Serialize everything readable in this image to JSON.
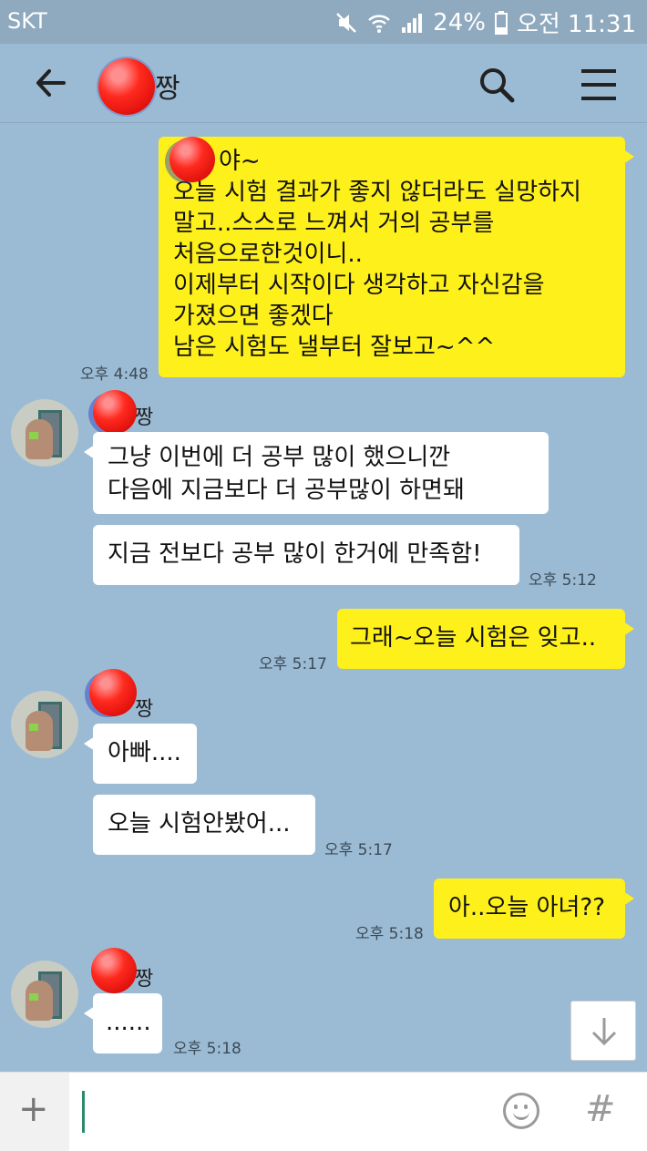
{
  "status_bar": {
    "carrier": "SKT",
    "battery": "24%",
    "time": "오전 11:31",
    "icons": [
      "mute-icon",
      "wifi-icon",
      "signal-icon",
      "battery-icon"
    ]
  },
  "header": {
    "title": "짱",
    "icons": [
      "back-arrow-icon",
      "search-icon",
      "menu-icon"
    ]
  },
  "messages": {
    "m1": {
      "lines": [
        "야~",
        "오늘 시험 결과가 좋지 않더라도 실망하지",
        "말고..스스로 느껴서 거의 공부를",
        "처음으로한것이니..",
        "이제부터 시작이다 생각하고 자신감을",
        "가졌으면 좋겠다",
        "남은 시험도 낼부터 잘보고~^^"
      ],
      "time": "오후 4:48"
    },
    "g1": {
      "name": "짱",
      "b1_lines": [
        "그냥 이번에 더 공부 많이 했으니깐",
        "다음에 지금보다 더 공부많이 하면돼"
      ],
      "b2": "지금 전보다 공부 많이 한거에 만족함!",
      "time": "오후 5:12"
    },
    "m2": {
      "text": "그래~오늘 시험은 잊고..",
      "time": "오후 5:17"
    },
    "g2": {
      "name": "짱",
      "b1": "아빠....",
      "b2": "오늘 시험안봤어...",
      "time": "오후 5:17"
    },
    "m3": {
      "text": "아..오늘 아녀??",
      "time": "오후 5:18"
    },
    "g3": {
      "name": "짱",
      "b1": "......",
      "time": "오후 5:18"
    }
  },
  "input_bar": {
    "plus": "+",
    "hash": "#",
    "icons": [
      "plus-icon",
      "emoji-icon",
      "hash-icon"
    ]
  },
  "colors": {
    "background": "#9bbbd4",
    "my_bubble": "#fef01b",
    "their_bubble": "#ffffff",
    "status_bar": "#8fa9be"
  }
}
